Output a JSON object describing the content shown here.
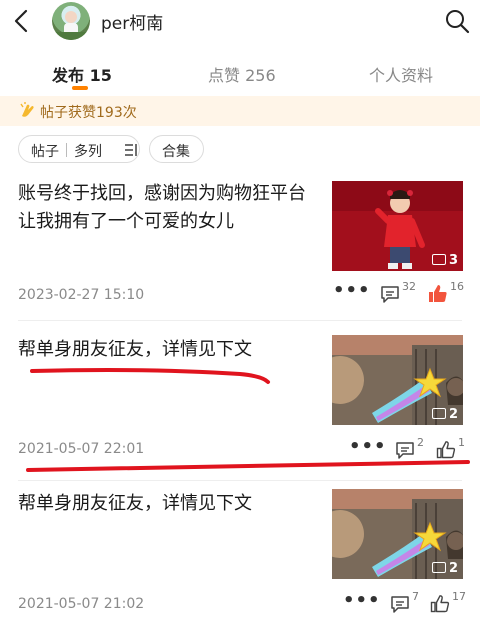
{
  "header": {
    "username": "per柯南",
    "back_icon": "chevron-left-icon",
    "search_icon": "search-icon"
  },
  "tabs": [
    {
      "label": "发布 15",
      "active": true
    },
    {
      "label": "点赞 256",
      "active": false
    },
    {
      "label": "个人资料",
      "active": false
    }
  ],
  "likes_banner": {
    "text": "帖子获赞193次",
    "icon": "clap-icon"
  },
  "filters": {
    "posts": "帖子",
    "layout": "多列",
    "collection": "合集"
  },
  "posts": [
    {
      "title": "账号终于找回，感谢因为购物狂平台让我拥有了一个可爱的女儿",
      "date": "2023-02-27 15:10",
      "image_count": "3",
      "comments": "32",
      "likes": "16",
      "liked": true
    },
    {
      "title": "帮单身朋友征友，详情见下文",
      "date": "2021-05-07 22:01",
      "image_count": "2",
      "comments": "2",
      "likes": "1",
      "liked": false
    },
    {
      "title": "帮单身朋友征友，详情见下文",
      "date": "2021-05-07 21:02",
      "image_count": "2",
      "comments": "7",
      "likes": "17",
      "liked": false
    }
  ],
  "colors": {
    "accent": "#ff8200",
    "liked": "#f2543d",
    "annotation": "#e0141e"
  }
}
